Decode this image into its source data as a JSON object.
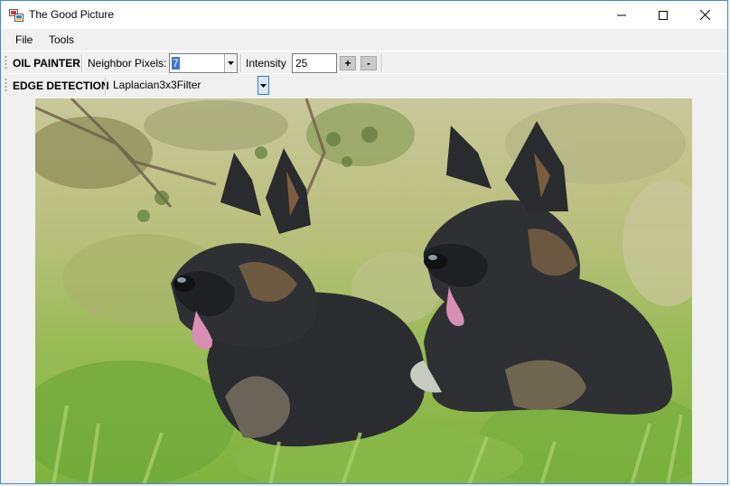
{
  "window": {
    "title": "The Good Picture"
  },
  "menu": {
    "items": [
      "File",
      "Tools"
    ]
  },
  "oil_painter": {
    "label": "OIL PAINTER",
    "neighbor_label": "Neighbor Pixels:",
    "neighbor_value": "7",
    "intensity_label": "Intensity",
    "intensity_value": "25",
    "plus_label": "+",
    "minus_label": "-"
  },
  "edge_detection": {
    "label": "EDGE DETECTION",
    "filter_value": "Laplacian3x3Filter"
  },
  "icons": {
    "app": "app-icon",
    "minimize": "minimize-icon",
    "maximize": "maximize-icon",
    "close": "close-icon",
    "dropdown": "chevron-down-icon"
  },
  "colors": {
    "selection": "#3a78d0",
    "window_border": "#3f8dd6"
  }
}
